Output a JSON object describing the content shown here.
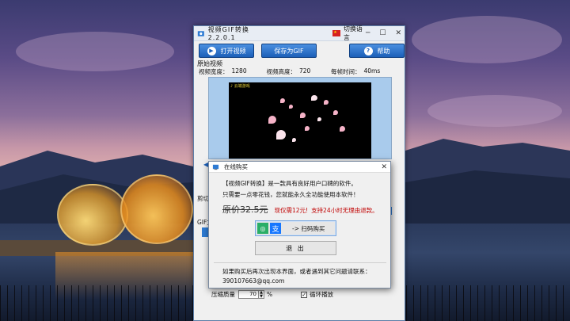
{
  "app": {
    "title": "视频GIF转换 2.2.0.1",
    "lang_button": "切换语言",
    "toolbar": {
      "open_label": "打开视频",
      "save_label": "保存为GIF",
      "help_label": "帮助"
    },
    "source_section": "原始视频",
    "info": {
      "width_label": "视频宽度：",
      "width_value": "1280",
      "height_label": "视频高度：",
      "height_value": "720",
      "frame_label": "每帧时间：",
      "frame_value": "40ms"
    },
    "video_label": "♪ 云端游戏",
    "cut_label": "剪切",
    "gif_label": "GIF文",
    "settings": {
      "quality_label": "压缩质量",
      "quality_value": "70",
      "percent": "%",
      "loop_label": "循环播放"
    }
  },
  "dialog": {
    "title": "在线购买",
    "line1": "【视频GIF转换】是一款具有良好用户口碑的软件。",
    "line2": "只需要一点零花钱，您就能永久全功能使用本软件！",
    "price_old": "原价32.5元",
    "price_new": "现仅需12元!",
    "refund": "支持24小时无理由退款。",
    "scan_label": "-> 扫码购买",
    "exit_label": "退 出",
    "contact_line": "如果购买后再次出现本界面，或者遇到其它问题请联系：",
    "contact_email": "390107663@qq.com"
  },
  "colors": {
    "accent": "#1c5fb8",
    "price_red": "#c00000",
    "wechat": "#2aae67",
    "alipay": "#1677ff"
  }
}
